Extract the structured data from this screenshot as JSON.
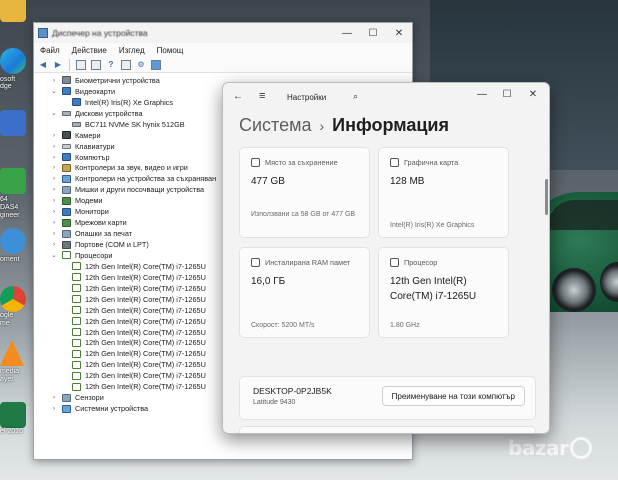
{
  "desktop": {
    "icons": [
      {
        "name": "yellow-folder-icon",
        "label": ""
      },
      {
        "name": "microsoft-edge-icon",
        "label": "osoft\ndge"
      },
      {
        "name": "app-icon",
        "label": ""
      },
      {
        "name": "mobaxterm-icon",
        "label": "64\nDAS4\ngineer"
      },
      {
        "name": "app-q-icon",
        "label": "oment"
      },
      {
        "name": "google-chrome-icon",
        "label": "ogle\nme"
      },
      {
        "name": "vlc-icon",
        "label": "media\nayer"
      },
      {
        "name": "excel-icon",
        "label": "el 2016"
      }
    ],
    "watermark": "bazar"
  },
  "device_manager": {
    "title": "Диспечер на устройства",
    "menu": [
      "Файл",
      "Действие",
      "Изглед",
      "Помощ"
    ],
    "tree": [
      {
        "level": 1,
        "expanded": false,
        "icon": "ico-bio",
        "label": "Биометрични устройства"
      },
      {
        "level": 1,
        "expanded": true,
        "icon": "ico-mon",
        "label": "Видеокарти"
      },
      {
        "level": 2,
        "icon": "ico-mon",
        "label": "Intel(R) Iris(R) Xe Graphics"
      },
      {
        "level": 1,
        "expanded": true,
        "icon": "ico-disk",
        "label": "Дискови устройства"
      },
      {
        "level": 2,
        "icon": "ico-disk",
        "label": "BC711 NVMe SK hynix 512GB"
      },
      {
        "level": 1,
        "expanded": false,
        "icon": "ico-cam",
        "label": "Камери"
      },
      {
        "level": 1,
        "expanded": false,
        "icon": "ico-kb",
        "label": "Клавиатури"
      },
      {
        "level": 1,
        "expanded": false,
        "icon": "ico-mon",
        "label": "Компютър"
      },
      {
        "level": 1,
        "expanded": false,
        "icon": "ico-snd",
        "label": "Контролери за звук, видео и игри"
      },
      {
        "level": 1,
        "expanded": false,
        "icon": "ico-chip",
        "label": "Контролери на устройства за съхраняван"
      },
      {
        "level": 1,
        "expanded": false,
        "icon": "ico-gen",
        "label": "Мишки и други посочващи устройства"
      },
      {
        "level": 1,
        "expanded": false,
        "icon": "ico-net",
        "label": "Модеми"
      },
      {
        "level": 1,
        "expanded": false,
        "icon": "ico-mon",
        "label": "Монитори"
      },
      {
        "level": 1,
        "expanded": false,
        "icon": "ico-net",
        "label": "Мрежови карти"
      },
      {
        "level": 1,
        "expanded": false,
        "icon": "ico-gen",
        "label": "Опашки за печат"
      },
      {
        "level": 1,
        "expanded": false,
        "icon": "ico-port",
        "label": "Портове (COM и LPT)"
      },
      {
        "level": 1,
        "expanded": true,
        "icon": "ico-cpu",
        "label": "Процесори"
      },
      {
        "level": 2,
        "icon": "ico-cpu",
        "label": "12th Gen Intel(R) Core(TM) i7-1265U"
      },
      {
        "level": 2,
        "icon": "ico-cpu",
        "label": "12th Gen Intel(R) Core(TM) i7-1265U"
      },
      {
        "level": 2,
        "icon": "ico-cpu",
        "label": "12th Gen Intel(R) Core(TM) i7-1265U"
      },
      {
        "level": 2,
        "icon": "ico-cpu",
        "label": "12th Gen Intel(R) Core(TM) i7-1265U"
      },
      {
        "level": 2,
        "icon": "ico-cpu",
        "label": "12th Gen Intel(R) Core(TM) i7-1265U"
      },
      {
        "level": 2,
        "icon": "ico-cpu",
        "label": "12th Gen Intel(R) Core(TM) i7-1265U"
      },
      {
        "level": 2,
        "icon": "ico-cpu",
        "label": "12th Gen Intel(R) Core(TM) i7-1265U"
      },
      {
        "level": 2,
        "icon": "ico-cpu",
        "label": "12th Gen Intel(R) Core(TM) i7-1265U"
      },
      {
        "level": 2,
        "icon": "ico-cpu",
        "label": "12th Gen Intel(R) Core(TM) i7-1265U"
      },
      {
        "level": 2,
        "icon": "ico-cpu",
        "label": "12th Gen Intel(R) Core(TM) i7-1265U"
      },
      {
        "level": 2,
        "icon": "ico-cpu",
        "label": "12th Gen Intel(R) Core(TM) i7-1265U"
      },
      {
        "level": 2,
        "icon": "ico-cpu",
        "label": "12th Gen Intel(R) Core(TM) i7-1265U"
      },
      {
        "level": 1,
        "expanded": false,
        "icon": "ico-gen",
        "label": "Сензори"
      },
      {
        "level": 1,
        "expanded": false,
        "icon": "ico-chip",
        "label": "Системни устройства"
      }
    ]
  },
  "settings": {
    "app_title": "Настройки",
    "breadcrumb_parent": "Система",
    "breadcrumb_current": "Информация",
    "cards": [
      {
        "label": "Място за съхранение",
        "value": "477 GB",
        "sub": "Използвани са 58 GB от 477 GB"
      },
      {
        "label": "Графична карта",
        "value": "128 MB",
        "sub": "Intel(R) Iris(R) Xe Graphics"
      },
      {
        "label": "Инсталирана RAM памет",
        "value": "16,0 ГБ",
        "sub": "Скорост: 5200 MT/s"
      },
      {
        "label": "Процесор",
        "value": "12th Gen Intel(R) Core(TM) i7-1265U",
        "sub": "1.80 GHz"
      }
    ],
    "device_name": "DESKTOP-0P2JB5K",
    "device_model": "Latitude 9430",
    "rename_button": "Преименуване на този компютър"
  }
}
